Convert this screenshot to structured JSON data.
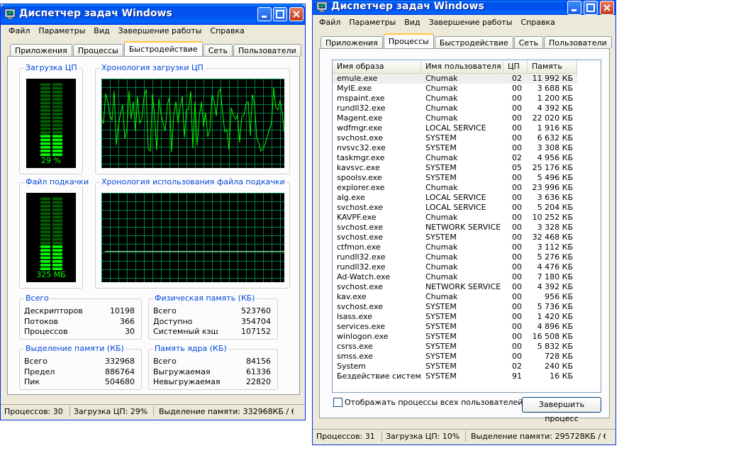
{
  "left": {
    "title": "Диспетчер задач Windows",
    "menu": [
      "Файл",
      "Параметры",
      "Вид",
      "Завершение работы",
      "Справка"
    ],
    "tabs": [
      "Приложения",
      "Процессы",
      "Быстродействие",
      "Сеть",
      "Пользователи"
    ],
    "active_tab": 2,
    "cpu_usage_label": "Загрузка ЦП",
    "cpu_usage_value": "29 %",
    "cpu_percent": 29,
    "cpu_history_label": "Хронология загрузки ЦП",
    "pf_label": "Файл подкачки",
    "pf_value": "325 МБ",
    "pf_history_label": "Хронология использования файла подкачки",
    "totals": {
      "label": "Всего",
      "rows": [
        {
          "k": "Дескрипторов",
          "v": "10198"
        },
        {
          "k": "Потоков",
          "v": "366"
        },
        {
          "k": "Процессов",
          "v": "30"
        }
      ]
    },
    "physical": {
      "label": "Физическая память (КБ)",
      "rows": [
        {
          "k": "Всего",
          "v": "523760"
        },
        {
          "k": "Доступно",
          "v": "354704"
        },
        {
          "k": "Системный кэш",
          "v": "107152"
        }
      ]
    },
    "commit": {
      "label": "Выделение памяти (КБ)",
      "rows": [
        {
          "k": "Всего",
          "v": "332968"
        },
        {
          "k": "Предел",
          "v": "886764"
        },
        {
          "k": "Пик",
          "v": "504680"
        }
      ]
    },
    "kernel": {
      "label": "Память ядра (КБ)",
      "rows": [
        {
          "k": "Всего",
          "v": "84156"
        },
        {
          "k": "Выгружаемая",
          "v": "61336"
        },
        {
          "k": "Невыгружаемая",
          "v": "22820"
        }
      ]
    },
    "status": [
      "Процессов: 30",
      "Загрузка ЦП: 29%",
      "Выделение памяти: 332968КБ / 6"
    ]
  },
  "right": {
    "title": "Диспетчер задач Windows",
    "menu": [
      "Файл",
      "Параметры",
      "Вид",
      "Завершение работы",
      "Справка"
    ],
    "tabs": [
      "Приложения",
      "Процессы",
      "Быстродействие",
      "Сеть",
      "Пользователи"
    ],
    "active_tab": 1,
    "columns": [
      "Имя образа",
      "Имя пользователя",
      "ЦП",
      "Память"
    ],
    "processes": [
      [
        "emule.exe",
        "Chumak",
        "02",
        "11 992 КБ"
      ],
      [
        "MyIE.exe",
        "Chumak",
        "00",
        "3 688 КБ"
      ],
      [
        "mspaint.exe",
        "Chumak",
        "00",
        "1 200 КБ"
      ],
      [
        "rundll32.exe",
        "Chumak",
        "00",
        "4 392 КБ"
      ],
      [
        "Magent.exe",
        "Chumak",
        "00",
        "22 020 КБ"
      ],
      [
        "wdfmgr.exe",
        "LOCAL SERVICE",
        "00",
        "1 916 КБ"
      ],
      [
        "svchost.exe",
        "SYSTEM",
        "00",
        "6 632 КБ"
      ],
      [
        "nvsvc32.exe",
        "SYSTEM",
        "00",
        "3 308 КБ"
      ],
      [
        "taskmgr.exe",
        "Chumak",
        "02",
        "4 956 КБ"
      ],
      [
        "kavsvc.exe",
        "SYSTEM",
        "05",
        "25 176 КБ"
      ],
      [
        "spoolsv.exe",
        "SYSTEM",
        "00",
        "5 496 КБ"
      ],
      [
        "explorer.exe",
        "Chumak",
        "00",
        "23 996 КБ"
      ],
      [
        "alg.exe",
        "LOCAL SERVICE",
        "00",
        "3 636 КБ"
      ],
      [
        "svchost.exe",
        "LOCAL SERVICE",
        "00",
        "5 204 КБ"
      ],
      [
        "KAVPF.exe",
        "Chumak",
        "00",
        "10 252 КБ"
      ],
      [
        "svchost.exe",
        "NETWORK SERVICE",
        "00",
        "3 328 КБ"
      ],
      [
        "svchost.exe",
        "SYSTEM",
        "00",
        "32 468 КБ"
      ],
      [
        "ctfmon.exe",
        "Chumak",
        "00",
        "3 112 КБ"
      ],
      [
        "rundll32.exe",
        "Chumak",
        "00",
        "5 276 КБ"
      ],
      [
        "rundll32.exe",
        "Chumak",
        "00",
        "4 476 КБ"
      ],
      [
        "Ad-Watch.exe",
        "Chumak",
        "00",
        "7 180 КБ"
      ],
      [
        "svchost.exe",
        "NETWORK SERVICE",
        "00",
        "4 392 КБ"
      ],
      [
        "kav.exe",
        "Chumak",
        "00",
        "956 КБ"
      ],
      [
        "svchost.exe",
        "SYSTEM",
        "00",
        "5 736 КБ"
      ],
      [
        "lsass.exe",
        "SYSTEM",
        "00",
        "1 420 КБ"
      ],
      [
        "services.exe",
        "SYSTEM",
        "00",
        "4 896 КБ"
      ],
      [
        "winlogon.exe",
        "SYSTEM",
        "00",
        "16 508 КБ"
      ],
      [
        "csrss.exe",
        "SYSTEM",
        "00",
        "5 832 КБ"
      ],
      [
        "smss.exe",
        "SYSTEM",
        "00",
        "728 КБ"
      ],
      [
        "System",
        "SYSTEM",
        "02",
        "240 КБ"
      ],
      [
        "Бездействие системы",
        "SYSTEM",
        "91",
        "16 КБ"
      ]
    ],
    "show_all_label": "Отображать процессы всех пользователей",
    "end_process_label": "Завершить процесс",
    "status": [
      "Процессов: 31",
      "Загрузка ЦП: 10%",
      "Выделение памяти: 295728КБ / 6"
    ]
  },
  "colors": {
    "graph_green": "#00ff00",
    "grid": "#008040",
    "title_blue": "#0053ee",
    "group_label": "#0046d5"
  }
}
